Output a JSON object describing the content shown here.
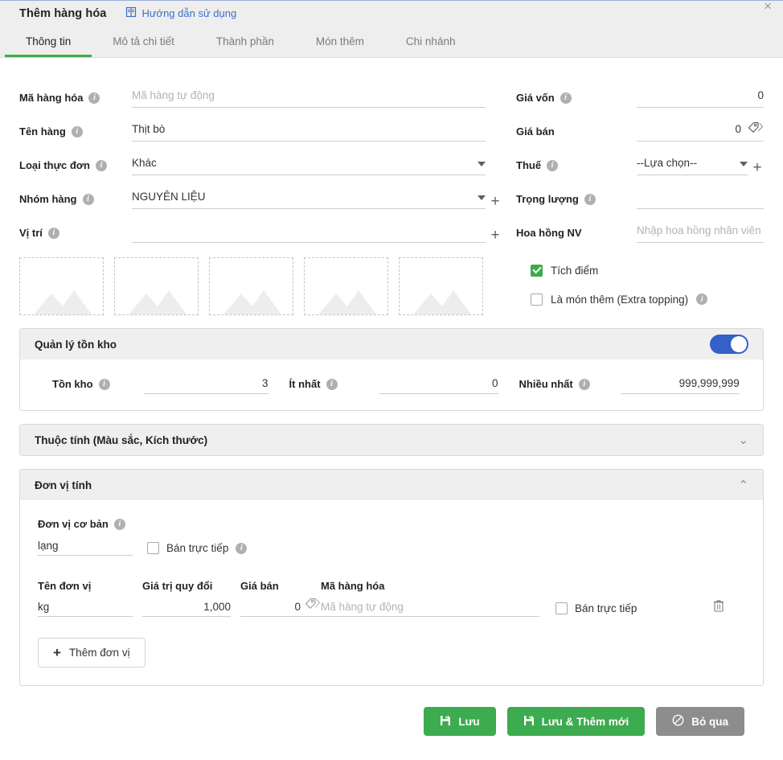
{
  "header": {
    "title": "Thêm hàng hóa",
    "guide_label": "Hướng dẫn sử dụng",
    "guide_icon": "manual-book-icon",
    "close_icon": "close-icon",
    "close_glyph": "×"
  },
  "tabs": [
    {
      "label": "Thông tin",
      "active": true
    },
    {
      "label": "Mô tả chi tiết",
      "active": false
    },
    {
      "label": "Thành phần",
      "active": false
    },
    {
      "label": "Món thêm",
      "active": false
    },
    {
      "label": "Chi nhánh",
      "active": false
    }
  ],
  "form_left": [
    {
      "label": "Mã hàng hóa",
      "value": "",
      "placeholder": "Mã hàng tự động",
      "has_info": true
    },
    {
      "label": "Tên hàng",
      "value": "Thịt bò",
      "placeholder": "",
      "has_info": true
    },
    {
      "label": "Loại thực đơn",
      "value": "Khác",
      "placeholder": "",
      "has_info": true
    },
    {
      "label": "Nhóm hàng",
      "value": "NGUYÊN LIỆU",
      "placeholder": "",
      "has_info": true
    },
    {
      "label": "Vị trí",
      "value": "",
      "placeholder": "",
      "has_info": true
    }
  ],
  "form_right": [
    {
      "label": "Giá vốn",
      "value": "0",
      "placeholder": "",
      "has_info": true
    },
    {
      "label": "Giá bán",
      "value": "0",
      "placeholder": "",
      "has_info": false
    },
    {
      "label": "Thuế",
      "value": "--Lựa chọn--",
      "placeholder": "",
      "has_info": true
    },
    {
      "label": "Trọng lượng",
      "value": "",
      "placeholder": "",
      "has_info": true
    },
    {
      "label": "Hoa hồng NV",
      "value": "",
      "placeholder": "Nhập hoa hồng nhân viên",
      "has_info": false
    }
  ],
  "images": {
    "count": 5,
    "icon": "image-placeholder-icon"
  },
  "checkboxes": [
    {
      "label": "Tích điểm",
      "checked": true,
      "has_info": false
    },
    {
      "label": "Là món thêm (Extra topping)",
      "checked": false,
      "has_info": true
    }
  ],
  "stock_panel": {
    "title": "Quản lý tồn kho",
    "toggle_on": true,
    "fields": [
      {
        "label": "Tồn kho",
        "value": "3",
        "has_info": true
      },
      {
        "label": "Ít nhất",
        "value": "0",
        "has_info": true
      },
      {
        "label": "Nhiều nhất",
        "value": "999,999,999",
        "has_info": true
      }
    ]
  },
  "attribute_panel": {
    "title": "Thuộc tính (Màu sắc, Kích thước)",
    "expanded": false,
    "chevron": "⌄"
  },
  "unit_panel": {
    "title": "Đơn vị tính",
    "expanded": true,
    "chevron": "⌃",
    "base_unit_label": "Đơn vị cơ bản",
    "base_unit_value": "lạng",
    "base_direct_sale_label": "Bán trực tiếp",
    "base_direct_sale_checked": false,
    "columns": {
      "name": "Tên đơn vị",
      "conversion": "Giá trị quy đổi",
      "price": "Giá bán",
      "code": "Mã hàng hóa"
    },
    "rows": [
      {
        "name": "kg",
        "conversion": "1,000",
        "price": "0",
        "code": "",
        "code_placeholder": "Mã hàng tự động",
        "direct_sale_label": "Bán trực tiếp",
        "direct_sale_checked": false,
        "delete_icon": "trash-icon"
      }
    ],
    "add_unit_label": "Thêm đơn vị"
  },
  "footer": {
    "save": {
      "label": "Lưu",
      "icon": "save-icon",
      "color": "#3dab4f"
    },
    "save_new": {
      "label": "Lưu & Thêm mới",
      "icon": "save-icon",
      "color": "#3dab4f"
    },
    "skip": {
      "label": "Bỏ qua",
      "icon": "ban-icon",
      "color": "#8d8d8d"
    }
  }
}
